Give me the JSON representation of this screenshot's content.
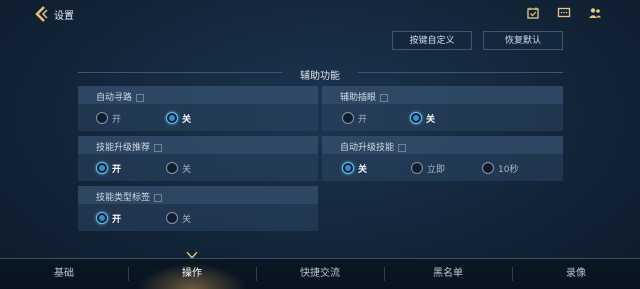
{
  "header": {
    "title": "设置",
    "icons": [
      "calendar-check-icon",
      "chat-icon",
      "friends-icon"
    ]
  },
  "actions": {
    "custom_keys": "按键自定义",
    "restore_default": "恢复默认"
  },
  "section": {
    "title": "辅助功能"
  },
  "settings": [
    {
      "label": "自动寻路",
      "options": [
        "开",
        "关"
      ],
      "selected": "关"
    },
    {
      "label": "辅助插眼",
      "options": [
        "开",
        "关"
      ],
      "selected": "关"
    },
    {
      "label": "技能升级推荐",
      "options": [
        "开",
        "关"
      ],
      "selected": "开"
    },
    {
      "label": "自动升级技能",
      "options": [
        "关",
        "立即",
        "10秒"
      ],
      "selected": "关"
    },
    {
      "label": "技能类型标签",
      "options": [
        "开",
        "关"
      ],
      "selected": "开"
    }
  ],
  "tabs": [
    {
      "label": "基础",
      "active": false
    },
    {
      "label": "操作",
      "active": true
    },
    {
      "label": "快捷交流",
      "active": false
    },
    {
      "label": "黑名单",
      "active": false
    },
    {
      "label": "录像",
      "active": false
    }
  ],
  "colors": {
    "accent": "#2f8fd6",
    "active_tab_glow": "#e0b460"
  }
}
